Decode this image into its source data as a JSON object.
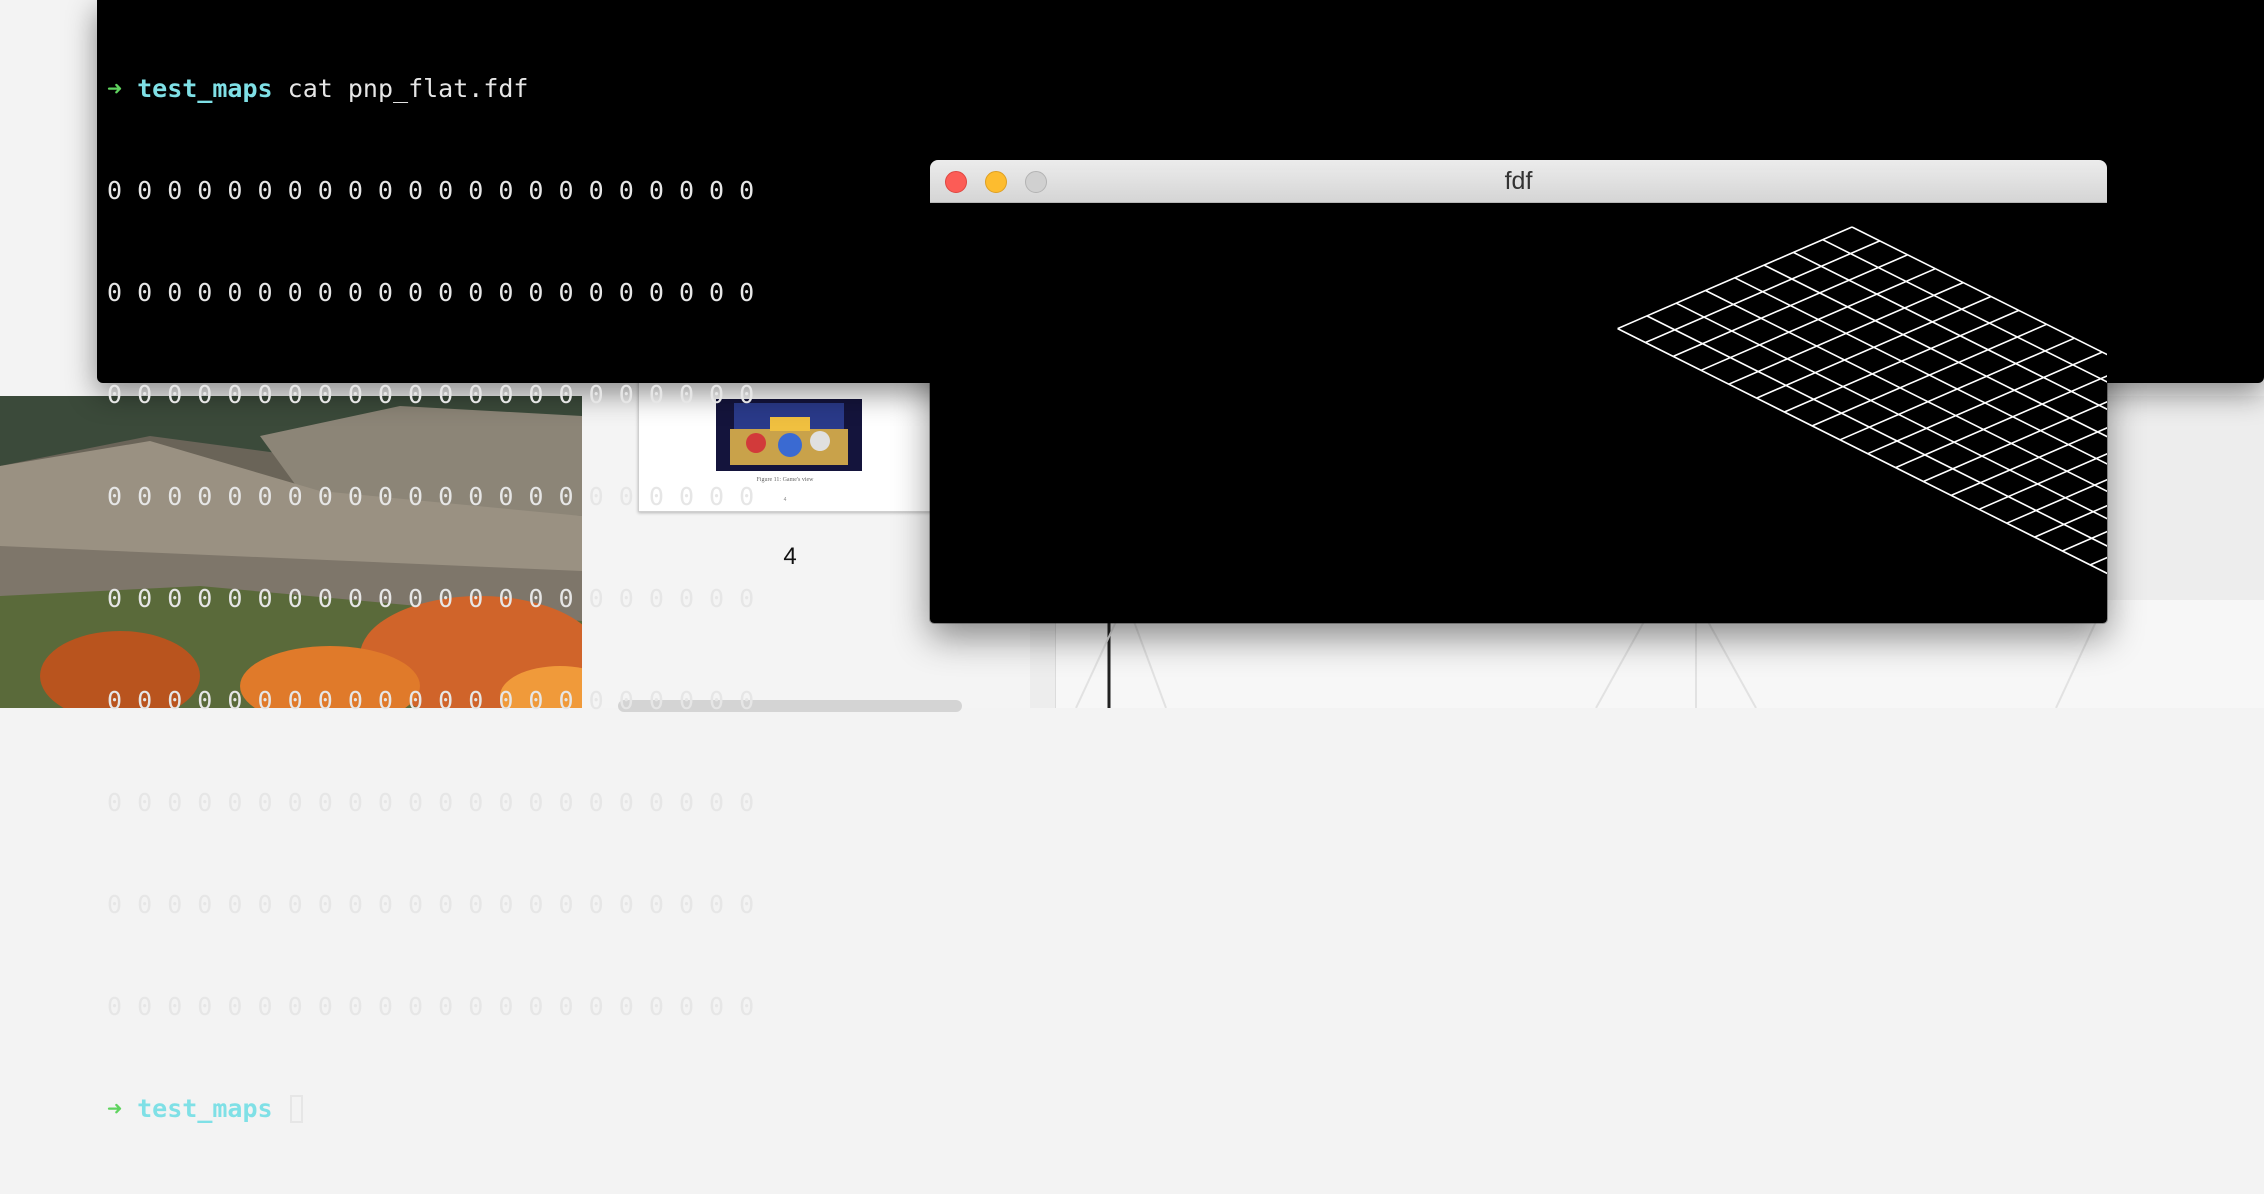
{
  "terminal": {
    "prompt_arrow": "➜",
    "prompt_dir": "test_maps",
    "command": "cat pnp_flat.fdf",
    "output_lines": [
      "0 0 0 0 0 0 0 0 0 0 0 0 0 0 0 0 0 0 0 0 0 0",
      "0 0 0 0 0 0 0 0 0 0 0 0 0 0 0 0 0 0 0 0 0 0",
      "0 0 0 0 0 0 0 0 0 0 0 0 0 0 0 0 0 0 0 0 0 0",
      "0 0 0 0 0 0 0 0 0 0 0 0 0 0 0 0 0 0 0 0 0 0",
      "0 0 0 0 0 0 0 0 0 0 0 0 0 0 0 0 0 0 0 0 0 0",
      "0 0 0 0 0 0 0 0 0 0 0 0 0 0 0 0 0 0 0 0 0 0",
      "0 0 0 0 0 0 0 0 0 0 0 0 0 0 0 0 0 0 0 0 0 0",
      "0 0 0 0 0 0 0 0 0 0 0 0 0 0 0 0 0 0 0 0 0 0",
      "0 0 0 0 0 0 0 0 0 0 0 0 0 0 0 0 0 0 0 0 0 0"
    ]
  },
  "fdf_window": {
    "title": "fdf",
    "grid": {
      "columns": 22,
      "rows": 9,
      "heights": 0,
      "line_color": "#ffffff",
      "background": "#000000"
    }
  },
  "background": {
    "preview_page_number": "4",
    "thumbnail_caption": "Figure 11: Game's view",
    "thumbnail_page": "4"
  },
  "colors": {
    "prompt_arrow": "#5fd35f",
    "prompt_dir": "#7fe0e6",
    "terminal_bg": "#000000",
    "close": "#fc5c56",
    "minimize": "#fdbc2f",
    "zoom_disabled": "#d0d0d0"
  }
}
